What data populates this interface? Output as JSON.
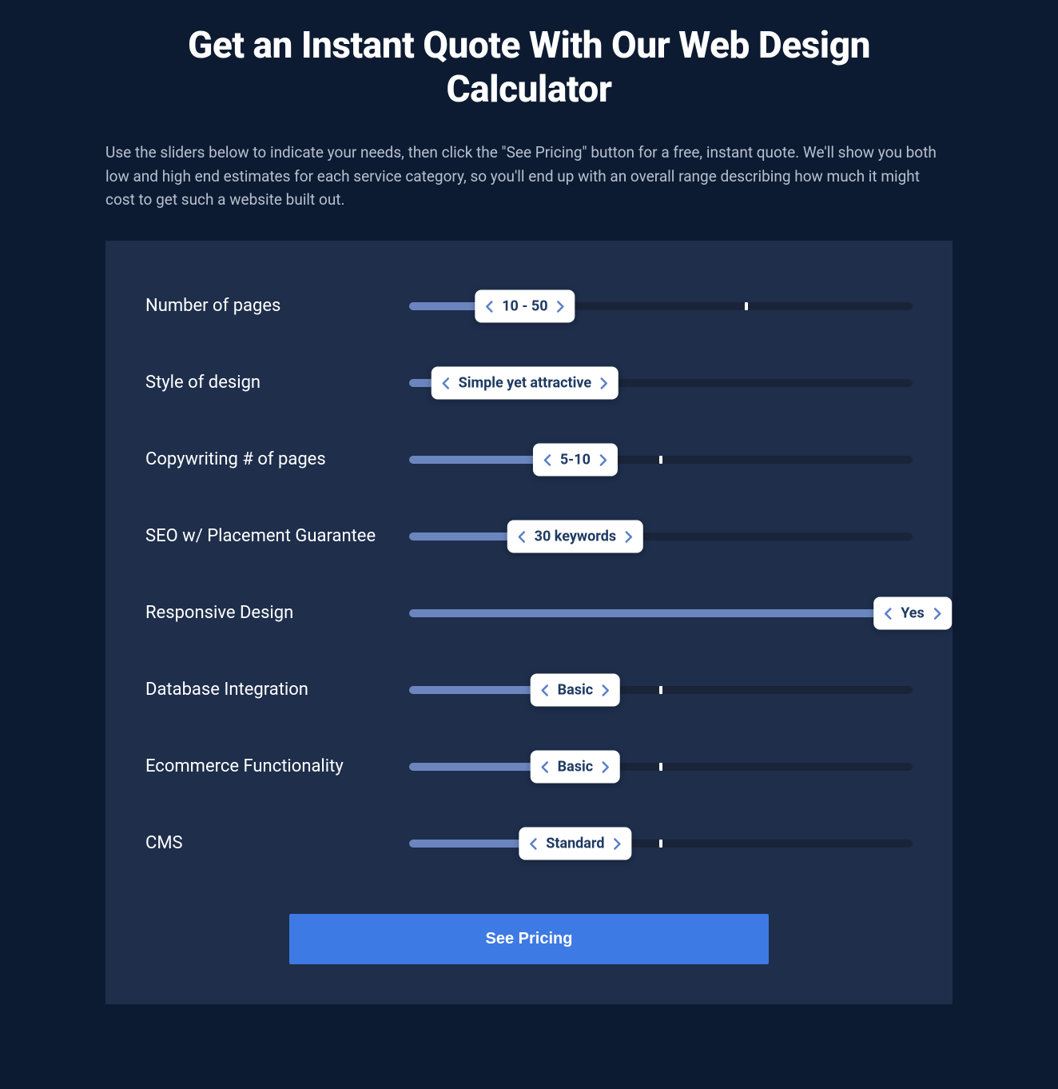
{
  "header": {
    "title": "Get an Instant Quote With Our Web Design Calculator",
    "description": "Use the sliders below to indicate your needs, then click the \"See Pricing\" button for a free, instant quote. We'll show you both low and high end estimates for each service category, so you'll end up with an overall range describing how much it might cost to get such a website built out."
  },
  "sliders": [
    {
      "label": "Number of pages",
      "value": "10 - 50",
      "fillPct": 23,
      "ticks": [
        67
      ]
    },
    {
      "label": "Style of design",
      "value": "Simple yet attractive",
      "fillPct": 23,
      "ticks": []
    },
    {
      "label": "Copywriting # of pages",
      "value": "5-10",
      "fillPct": 33,
      "ticks": [
        50
      ]
    },
    {
      "label": "SEO w/ Placement Guarantee",
      "value": "30 keywords",
      "fillPct": 33,
      "ticks": []
    },
    {
      "label": "Responsive Design",
      "value": "Yes",
      "fillPct": 100,
      "ticks": []
    },
    {
      "label": "Database Integration",
      "value": "Basic",
      "fillPct": 33,
      "ticks": [
        50
      ]
    },
    {
      "label": "Ecommerce Functionality",
      "value": "Basic",
      "fillPct": 33,
      "ticks": [
        50
      ]
    },
    {
      "label": "CMS",
      "value": "Standard",
      "fillPct": 33,
      "ticks": [
        50
      ]
    }
  ],
  "cta": {
    "label": "See Pricing"
  },
  "colors": {
    "bg": "#0d1b32",
    "panel": "#1e2e4b",
    "fill": "#6b86bf",
    "empty": "#1a2438",
    "accent": "#3e7ae3"
  }
}
